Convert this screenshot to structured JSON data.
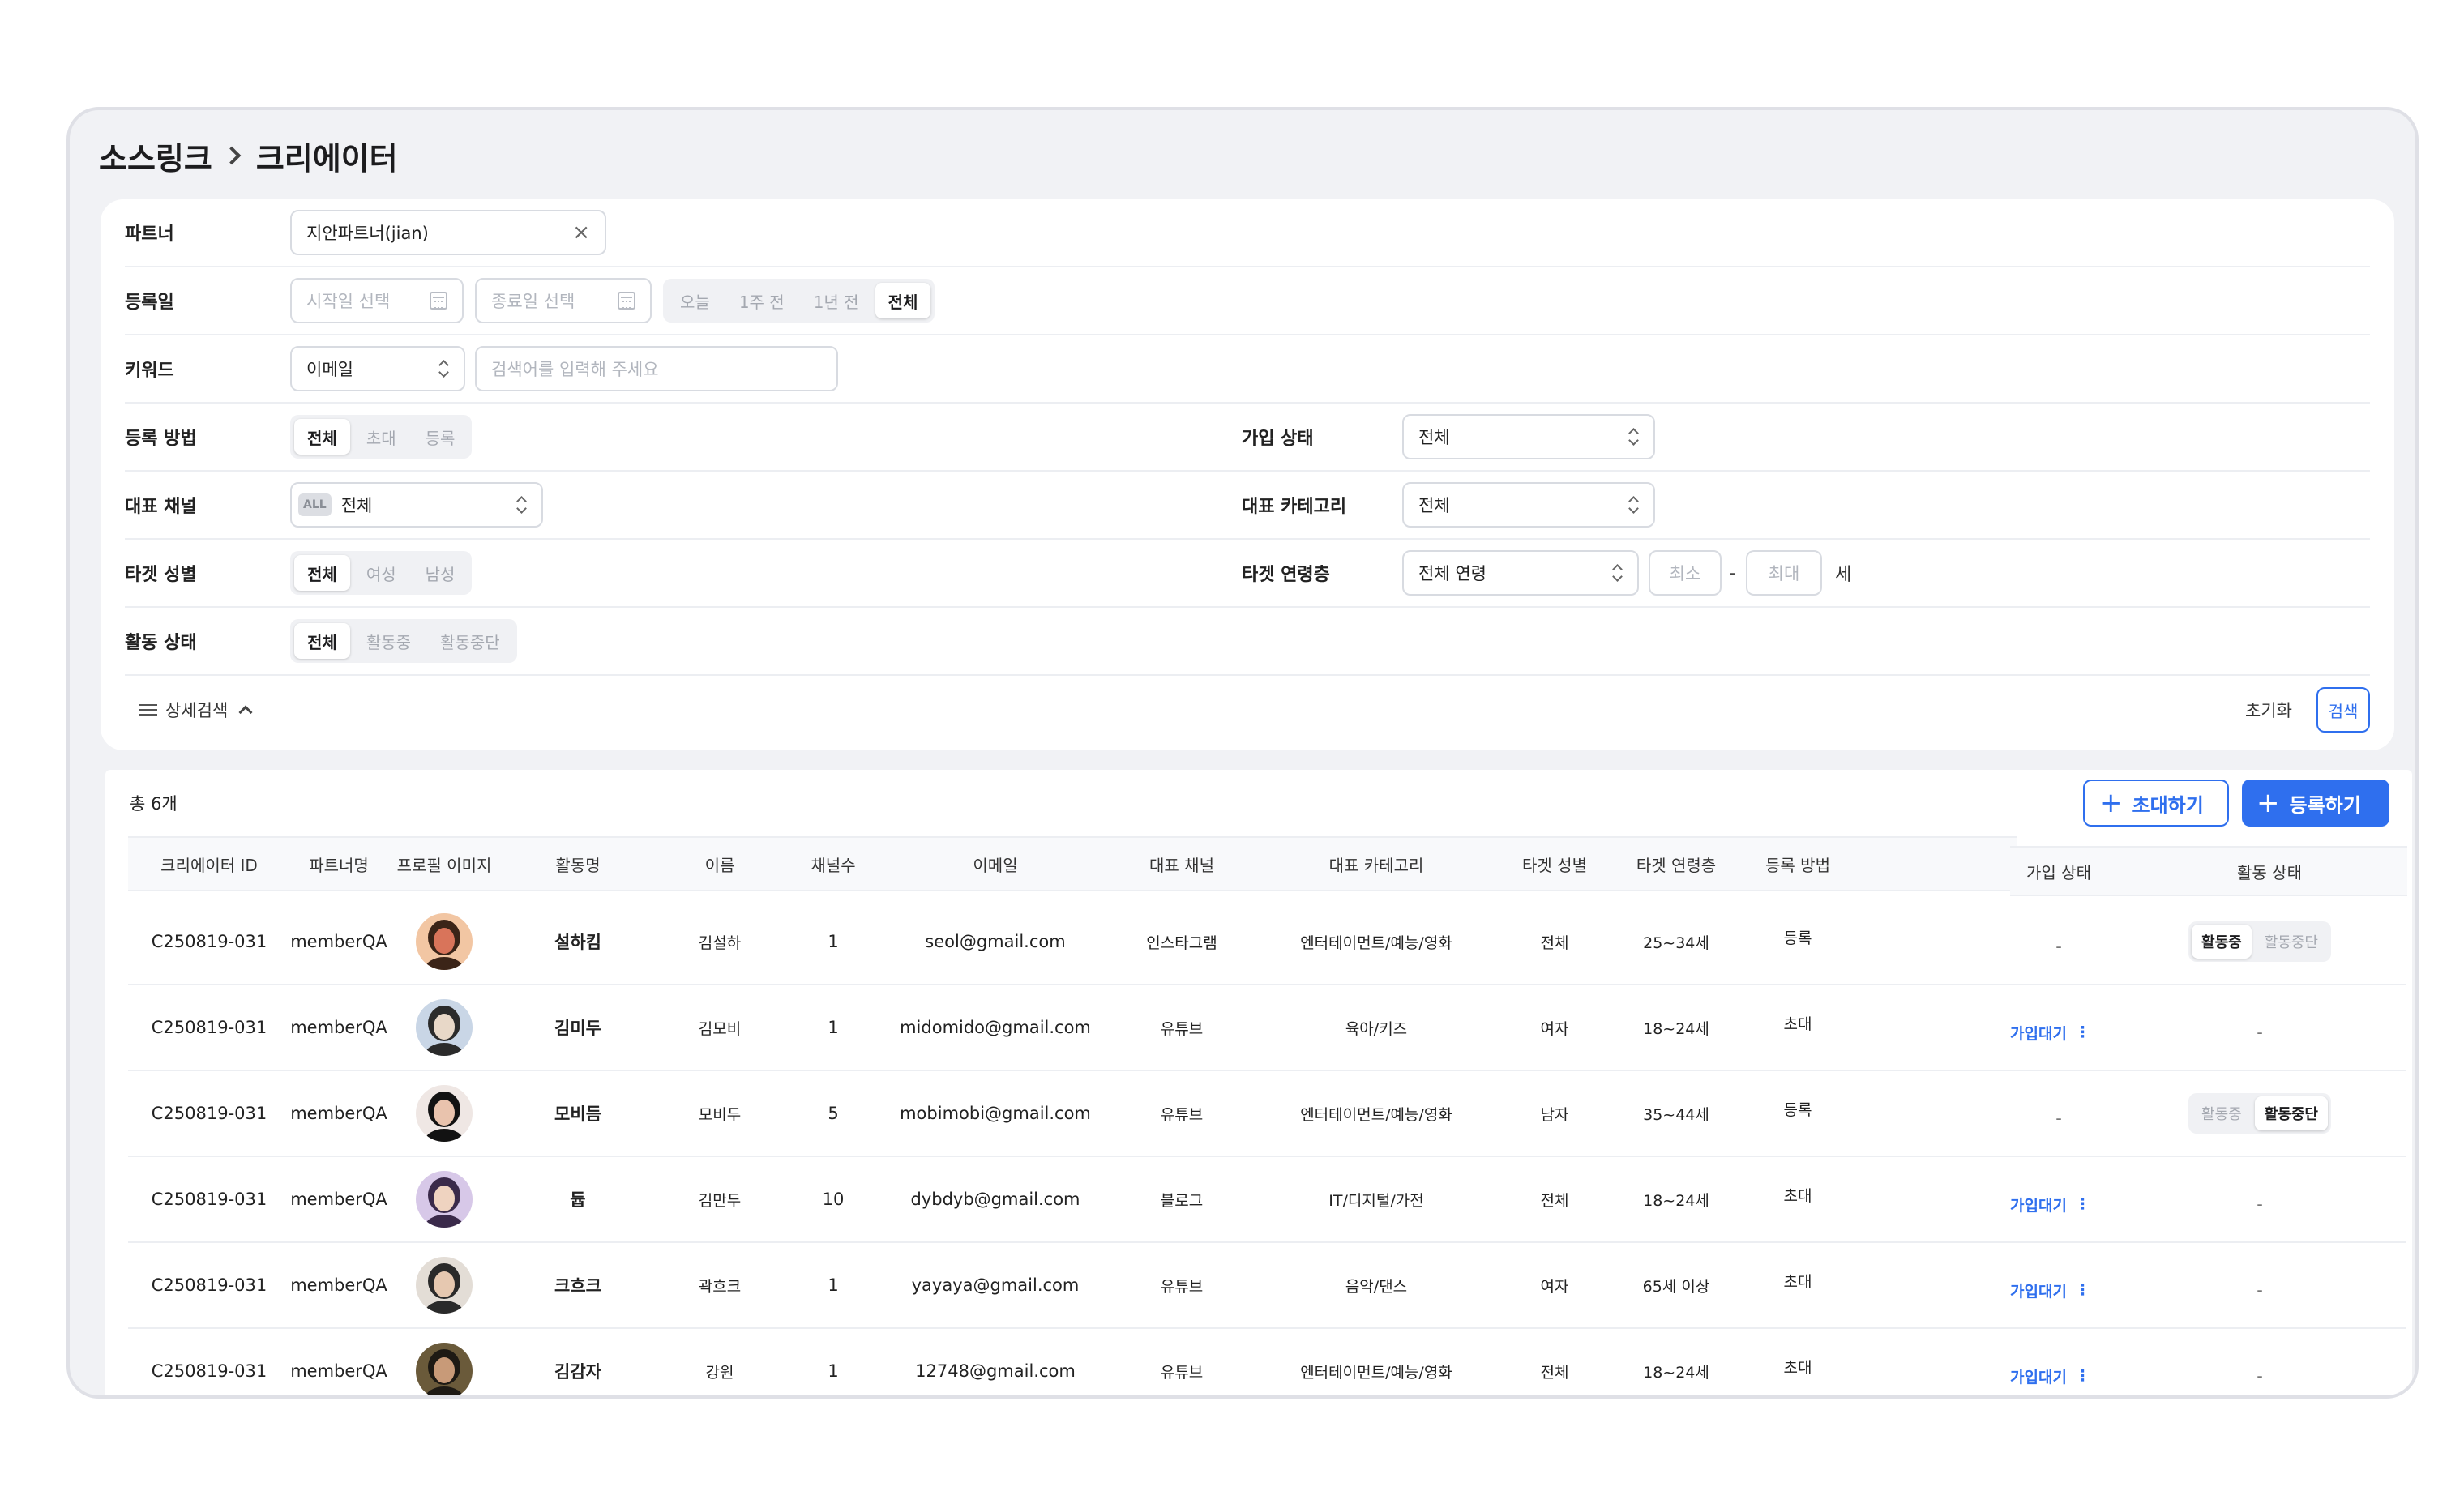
{
  "breadcrumb": [
    "소스링크",
    "크리에이터"
  ],
  "filter": {
    "partner": {
      "label": "파트너",
      "value": "지안파트너(jian)"
    },
    "reg_date": {
      "label": "등록일",
      "start_placeholder": "시작일 선택",
      "end_placeholder": "종료일 선택",
      "ranges": [
        "오늘",
        "1주 전",
        "1년 전",
        "전체"
      ],
      "selected": "전체"
    },
    "keyword": {
      "label": "키워드",
      "type_value": "이메일",
      "placeholder": "검색어를 입력해 주세요"
    },
    "reg_method": {
      "label": "등록 방법",
      "options": [
        "전체",
        "초대",
        "등록"
      ],
      "selected": "전체"
    },
    "join_status": {
      "label": "가입 상태",
      "value": "전체"
    },
    "main_channel": {
      "label": "대표 채널",
      "badge": "ALL",
      "value": "전체"
    },
    "main_category": {
      "label": "대표 카테고리",
      "value": "전체"
    },
    "target_gender": {
      "label": "타겟 성별",
      "options": [
        "전체",
        "여성",
        "남성"
      ],
      "selected": "전체"
    },
    "target_age": {
      "label": "타겟 연령층",
      "value": "전체 연령",
      "min_placeholder": "최소",
      "max_placeholder": "최대",
      "dash": "-",
      "unit": "세"
    },
    "activity": {
      "label": "활동 상태",
      "options": [
        "전체",
        "활동중",
        "활동중단"
      ],
      "selected": "전체"
    },
    "advanced_label": "상세검색",
    "reset_label": "초기화",
    "search_label": "검색"
  },
  "table": {
    "total": "총 6개",
    "invite_label": "초대하기",
    "register_label": "등록하기",
    "columns": [
      "크리에이터 ID",
      "파트너명",
      "프로필 이미지",
      "활동명",
      "이름",
      "채널수",
      "이메일",
      "대표 채널",
      "대표 카테고리",
      "타겟 성별",
      "타겟 연령층",
      "등록 방법",
      "가입 상태",
      "활동 상태"
    ],
    "rows": [
      {
        "id": "C250819-031",
        "partner": "memberQA",
        "nickname": "설하킴",
        "name": "김설하",
        "channels": "1",
        "email": "seol@gmail.com",
        "channel": "인스타그램",
        "category": "엔터테이먼트/예능/영화",
        "gender": "전체",
        "age": "25~34세",
        "method": "등록",
        "join": "-",
        "activity_on": "활동중",
        "activity_off": "활동중단",
        "activity_selected": "활동중"
      },
      {
        "id": "C250819-031",
        "partner": "memberQA",
        "nickname": "김미두",
        "name": "김모비",
        "channels": "1",
        "email": "midomido@gmail.com",
        "channel": "유튜브",
        "category": "육아/키즈",
        "gender": "여자",
        "age": "18~24세",
        "method": "초대",
        "join": "가입대기",
        "activity": "-"
      },
      {
        "id": "C250819-031",
        "partner": "memberQA",
        "nickname": "모비듬",
        "name": "모비두",
        "channels": "5",
        "email": "mobimobi@gmail.com",
        "channel": "유튜브",
        "category": "엔터테이먼트/예능/영화",
        "gender": "남자",
        "age": "35~44세",
        "method": "등록",
        "join": "-",
        "activity_on": "활동중",
        "activity_off": "활동중단",
        "activity_selected": "활동중단"
      },
      {
        "id": "C250819-031",
        "partner": "memberQA",
        "nickname": "듑",
        "name": "김만두",
        "channels": "10",
        "email": "dybdyb@gmail.com",
        "channel": "블로그",
        "category": "IT/디지털/가전",
        "gender": "전체",
        "age": "18~24세",
        "method": "초대",
        "join": "가입대기",
        "activity": "-"
      },
      {
        "id": "C250819-031",
        "partner": "memberQA",
        "nickname": "크흐크",
        "name": "곽흐크",
        "channels": "1",
        "email": "yayaya@gmail.com",
        "channel": "유튜브",
        "category": "음악/댄스",
        "gender": "여자",
        "age": "65세 이상",
        "method": "초대",
        "join": "가입대기",
        "activity": "-"
      },
      {
        "id": "C250819-031",
        "partner": "memberQA",
        "nickname": "김감자",
        "name": "강원",
        "channels": "1",
        "email": "12748@gmail.com",
        "channel": "유튜브",
        "category": "엔터테이먼트/예능/영화",
        "gender": "전체",
        "age": "18~24세",
        "method": "초대",
        "join": "가입대기",
        "activity": "-"
      }
    ]
  },
  "colors": {
    "accent": "#2f6fee",
    "panel_bg": "#f1f2f5"
  },
  "icons": [
    "chevron-right-icon",
    "close-icon",
    "calendar-icon",
    "updown-icon",
    "sliders-icon",
    "chevron-up-icon",
    "plus-icon",
    "kebab-icon"
  ]
}
